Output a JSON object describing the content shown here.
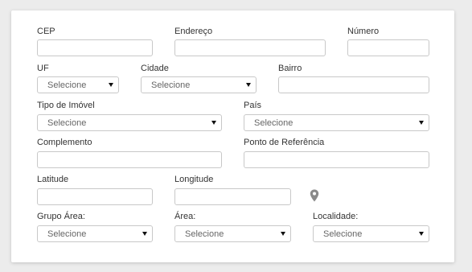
{
  "form": {
    "cep": {
      "label": "CEP",
      "value": ""
    },
    "endereco": {
      "label": "Endereço",
      "value": ""
    },
    "numero": {
      "label": "Número",
      "value": ""
    },
    "uf": {
      "label": "UF",
      "selected": "Selecione"
    },
    "cidade": {
      "label": "Cidade",
      "selected": "Selecione"
    },
    "bairro": {
      "label": "Bairro",
      "value": ""
    },
    "tipo_imovel": {
      "label": "Tipo de Imóvel",
      "selected": "Selecione"
    },
    "pais": {
      "label": "País",
      "selected": "Selecione"
    },
    "complemento": {
      "label": "Complemento",
      "value": ""
    },
    "ponto_referencia": {
      "label": "Ponto de Referência",
      "value": ""
    },
    "latitude": {
      "label": "Latitude",
      "value": ""
    },
    "longitude": {
      "label": "Longitude",
      "value": ""
    },
    "grupo_area": {
      "label": "Grupo Área:",
      "selected": "Selecione"
    },
    "area": {
      "label": "Área:",
      "selected": "Selecione"
    },
    "localidade": {
      "label": "Localidade:",
      "selected": "Selecione"
    }
  },
  "icons": {
    "map_pin": "map-pin-icon"
  },
  "colors": {
    "pin": "#8a8a8a",
    "border": "#c8c8c8"
  }
}
